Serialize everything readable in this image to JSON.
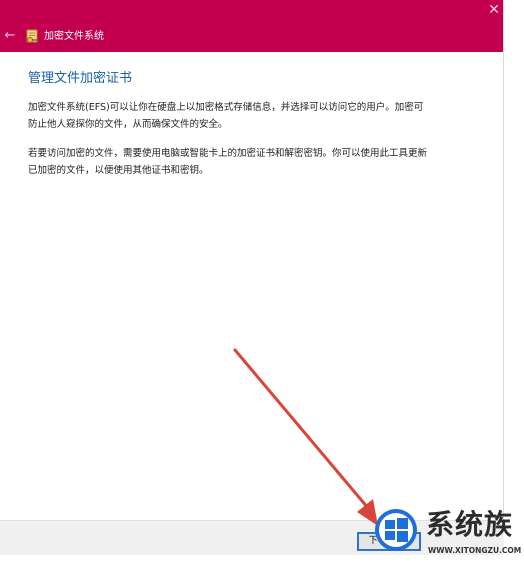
{
  "window": {
    "title": "加密文件系统",
    "back_glyph": "←",
    "close_glyph": "✕",
    "accent_color": "#c2004f"
  },
  "content": {
    "heading": "管理文件加密证书",
    "paragraph1": "加密文件系统(EFS)可以让你在硬盘上以加密格式存储信息，并选择可以访问它的用户。加密可防止他人窥探你的文件，从而确保文件的安全。",
    "paragraph2": "若要访问加密的文件，需要使用电脑或智能卡上的加密证书和解密密钥。你可以使用此工具更新已加密的文件，以便使用其他证书和密钥。"
  },
  "footer": {
    "next_button_label": "下一步(N)"
  },
  "annotation": {
    "arrow_color": "#d9453c"
  },
  "watermark": {
    "site_name": "系统族",
    "url": "WWW.XITONGZU.COM",
    "icon": "windows-logo-icon"
  }
}
